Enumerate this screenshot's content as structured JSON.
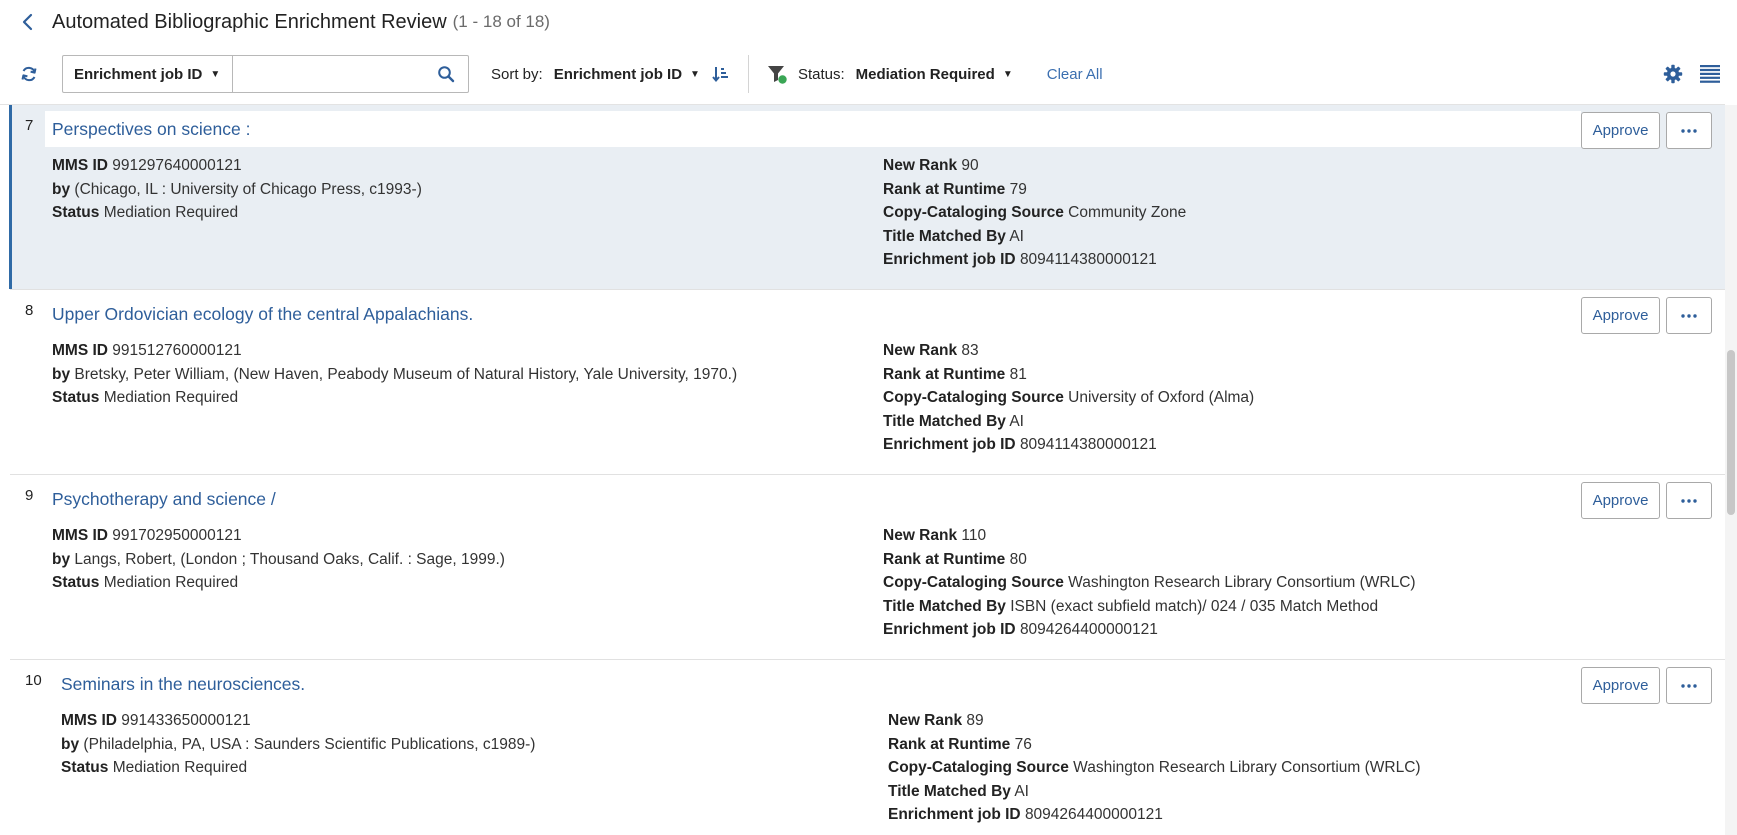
{
  "header": {
    "title": "Automated Bibliographic Enrichment Review",
    "count": "(1 - 18 of 18)"
  },
  "toolbar": {
    "search_field": "Enrichment job ID",
    "search_value": "",
    "sort_label": "Sort by:",
    "sort_value": "Enrichment job ID",
    "status_label": "Status:",
    "status_value": "Mediation Required",
    "clear_all": "Clear All"
  },
  "labels": {
    "mms_id": "MMS ID",
    "by": "by",
    "status": "Status",
    "new_rank": "New Rank",
    "rank_at_runtime": "Rank at Runtime",
    "copy_source": "Copy-Cataloging Source",
    "title_matched_by": "Title Matched By",
    "enrichment_job_id": "Enrichment job ID",
    "approve": "Approve"
  },
  "rows": [
    {
      "num": "7",
      "title": "Perspectives on science :",
      "mms_id": "991297640000121",
      "by": " (Chicago, IL : University of Chicago Press, c1993-)",
      "status": "Mediation Required",
      "new_rank": "90",
      "rank_at_runtime": "79",
      "copy_source": "Community Zone",
      "title_matched_by": "AI",
      "enrichment_job_id": "8094114380000121"
    },
    {
      "num": "8",
      "title": "Upper Ordovician ecology of the central Appalachians.",
      "mms_id": "991512760000121",
      "by": "Bretsky, Peter William, (New Haven, Peabody Museum of Natural History, Yale University, 1970.)",
      "status": "Mediation Required",
      "new_rank": "83",
      "rank_at_runtime": "81",
      "copy_source": "University of Oxford (Alma)",
      "title_matched_by": "AI",
      "enrichment_job_id": "8094114380000121"
    },
    {
      "num": "9",
      "title": "Psychotherapy and science /",
      "mms_id": "991702950000121",
      "by": "Langs, Robert, (London ; Thousand Oaks, Calif. : Sage, 1999.)",
      "status": "Mediation Required",
      "new_rank": "110",
      "rank_at_runtime": "80",
      "copy_source": "Washington Research Library Consortium (WRLC)",
      "title_matched_by": "ISBN (exact subfield match)/ 024 / 035 Match Method",
      "enrichment_job_id": "8094264400000121"
    },
    {
      "num": "10",
      "title": "Seminars in the neurosciences.",
      "mms_id": "991433650000121",
      "by": " (Philadelphia, PA, USA : Saunders Scientific Publications, c1989-)",
      "status": "Mediation Required",
      "new_rank": "89",
      "rank_at_runtime": "76",
      "copy_source": "Washington Research Library Consortium (WRLC)",
      "title_matched_by": "AI",
      "enrichment_job_id": "8094264400000121"
    }
  ],
  "colors": {
    "link": "#2e5e9a",
    "accent": "#2f6aa6",
    "selected_bg": "#e9eef3",
    "filter_dot": "#3aa655"
  }
}
